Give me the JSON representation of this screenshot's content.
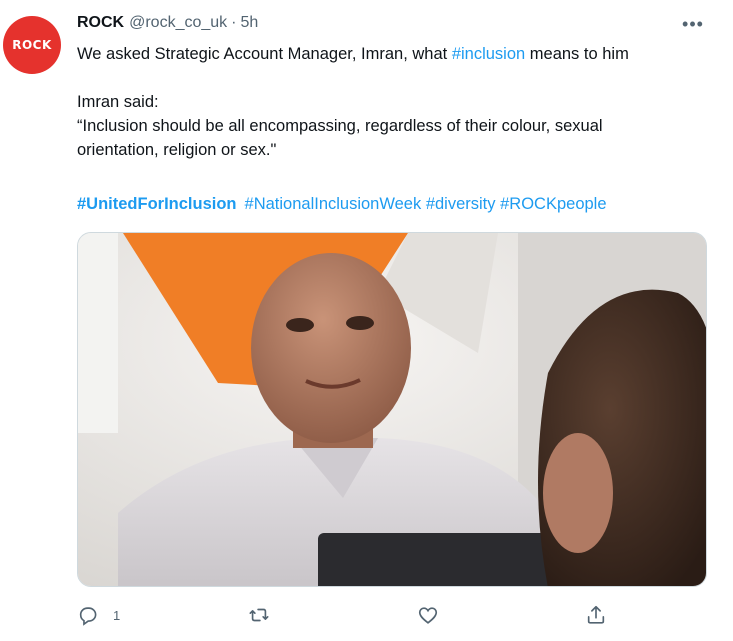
{
  "tweet": {
    "avatar_text": "ROCK",
    "display_name": "ROCK",
    "handle": "@rock_co_uk",
    "separator": "·",
    "time": "5h",
    "more_label": "•••",
    "text_line1_pre": "We asked Strategic Account Manager, Imran, what ",
    "text_line1_hashtag": "#inclusion",
    "text_line1_post": " means to him",
    "text_line2": "Imran said:",
    "text_line3": "“Inclusion should be all encompassing, regardless of their colour, sexual",
    "text_line4": "orientation, religion or sex.\"",
    "hashtags": [
      "#UnitedForInclusion",
      "#NationalInclusionWeek",
      "#diversity",
      "#ROCKpeople"
    ],
    "reply_count": "1"
  },
  "icons": {
    "reply": "reply-icon",
    "retweet": "retweet-icon",
    "like": "heart-icon",
    "share": "share-icon",
    "more": "more-icon"
  },
  "colors": {
    "brand_red": "#e5322d",
    "link_blue": "#1d9bf0",
    "secondary_text": "#536471",
    "accent_orange": "#f07e26"
  }
}
